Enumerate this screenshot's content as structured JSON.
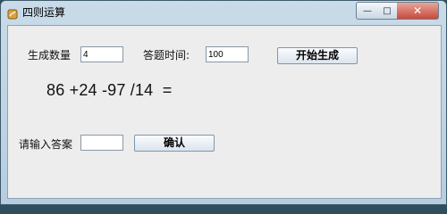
{
  "window": {
    "title": "四则运算",
    "controls": {
      "minimize": "—",
      "maximize": "□",
      "close": "✕"
    }
  },
  "form": {
    "count_label": "生成数量",
    "count_value": "4",
    "time_label": "答题时间:",
    "time_value": "100",
    "generate_button": "开始生成",
    "problem_text": "86 +24 -97 /14  =",
    "answer_label": "请输入答案",
    "answer_value": "",
    "confirm_button": "确认"
  },
  "colors": {
    "titlebar": "#c9dbe8",
    "panel": "#ededed",
    "close_button": "#c74a3b"
  },
  "icons": {
    "app": "java-app-icon",
    "minimize": "minimize-icon",
    "maximize": "maximize-icon",
    "close": "close-icon"
  }
}
